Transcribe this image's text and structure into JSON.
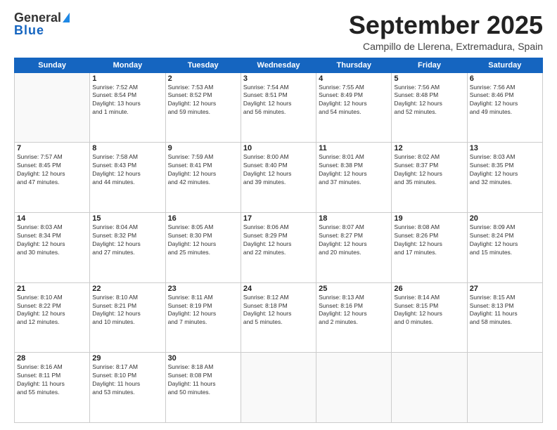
{
  "logo": {
    "line1": "General",
    "line2": "Blue"
  },
  "header": {
    "month": "September 2025",
    "location": "Campillo de Llerena, Extremadura, Spain"
  },
  "weekdays": [
    "Sunday",
    "Monday",
    "Tuesday",
    "Wednesday",
    "Thursday",
    "Friday",
    "Saturday"
  ],
  "weeks": [
    [
      {
        "num": "",
        "info": ""
      },
      {
        "num": "1",
        "info": "Sunrise: 7:52 AM\nSunset: 8:54 PM\nDaylight: 13 hours\nand 1 minute."
      },
      {
        "num": "2",
        "info": "Sunrise: 7:53 AM\nSunset: 8:52 PM\nDaylight: 12 hours\nand 59 minutes."
      },
      {
        "num": "3",
        "info": "Sunrise: 7:54 AM\nSunset: 8:51 PM\nDaylight: 12 hours\nand 56 minutes."
      },
      {
        "num": "4",
        "info": "Sunrise: 7:55 AM\nSunset: 8:49 PM\nDaylight: 12 hours\nand 54 minutes."
      },
      {
        "num": "5",
        "info": "Sunrise: 7:56 AM\nSunset: 8:48 PM\nDaylight: 12 hours\nand 52 minutes."
      },
      {
        "num": "6",
        "info": "Sunrise: 7:56 AM\nSunset: 8:46 PM\nDaylight: 12 hours\nand 49 minutes."
      }
    ],
    [
      {
        "num": "7",
        "info": "Sunrise: 7:57 AM\nSunset: 8:45 PM\nDaylight: 12 hours\nand 47 minutes."
      },
      {
        "num": "8",
        "info": "Sunrise: 7:58 AM\nSunset: 8:43 PM\nDaylight: 12 hours\nand 44 minutes."
      },
      {
        "num": "9",
        "info": "Sunrise: 7:59 AM\nSunset: 8:41 PM\nDaylight: 12 hours\nand 42 minutes."
      },
      {
        "num": "10",
        "info": "Sunrise: 8:00 AM\nSunset: 8:40 PM\nDaylight: 12 hours\nand 39 minutes."
      },
      {
        "num": "11",
        "info": "Sunrise: 8:01 AM\nSunset: 8:38 PM\nDaylight: 12 hours\nand 37 minutes."
      },
      {
        "num": "12",
        "info": "Sunrise: 8:02 AM\nSunset: 8:37 PM\nDaylight: 12 hours\nand 35 minutes."
      },
      {
        "num": "13",
        "info": "Sunrise: 8:03 AM\nSunset: 8:35 PM\nDaylight: 12 hours\nand 32 minutes."
      }
    ],
    [
      {
        "num": "14",
        "info": "Sunrise: 8:03 AM\nSunset: 8:34 PM\nDaylight: 12 hours\nand 30 minutes."
      },
      {
        "num": "15",
        "info": "Sunrise: 8:04 AM\nSunset: 8:32 PM\nDaylight: 12 hours\nand 27 minutes."
      },
      {
        "num": "16",
        "info": "Sunrise: 8:05 AM\nSunset: 8:30 PM\nDaylight: 12 hours\nand 25 minutes."
      },
      {
        "num": "17",
        "info": "Sunrise: 8:06 AM\nSunset: 8:29 PM\nDaylight: 12 hours\nand 22 minutes."
      },
      {
        "num": "18",
        "info": "Sunrise: 8:07 AM\nSunset: 8:27 PM\nDaylight: 12 hours\nand 20 minutes."
      },
      {
        "num": "19",
        "info": "Sunrise: 8:08 AM\nSunset: 8:26 PM\nDaylight: 12 hours\nand 17 minutes."
      },
      {
        "num": "20",
        "info": "Sunrise: 8:09 AM\nSunset: 8:24 PM\nDaylight: 12 hours\nand 15 minutes."
      }
    ],
    [
      {
        "num": "21",
        "info": "Sunrise: 8:10 AM\nSunset: 8:22 PM\nDaylight: 12 hours\nand 12 minutes."
      },
      {
        "num": "22",
        "info": "Sunrise: 8:10 AM\nSunset: 8:21 PM\nDaylight: 12 hours\nand 10 minutes."
      },
      {
        "num": "23",
        "info": "Sunrise: 8:11 AM\nSunset: 8:19 PM\nDaylight: 12 hours\nand 7 minutes."
      },
      {
        "num": "24",
        "info": "Sunrise: 8:12 AM\nSunset: 8:18 PM\nDaylight: 12 hours\nand 5 minutes."
      },
      {
        "num": "25",
        "info": "Sunrise: 8:13 AM\nSunset: 8:16 PM\nDaylight: 12 hours\nand 2 minutes."
      },
      {
        "num": "26",
        "info": "Sunrise: 8:14 AM\nSunset: 8:15 PM\nDaylight: 12 hours\nand 0 minutes."
      },
      {
        "num": "27",
        "info": "Sunrise: 8:15 AM\nSunset: 8:13 PM\nDaylight: 11 hours\nand 58 minutes."
      }
    ],
    [
      {
        "num": "28",
        "info": "Sunrise: 8:16 AM\nSunset: 8:11 PM\nDaylight: 11 hours\nand 55 minutes."
      },
      {
        "num": "29",
        "info": "Sunrise: 8:17 AM\nSunset: 8:10 PM\nDaylight: 11 hours\nand 53 minutes."
      },
      {
        "num": "30",
        "info": "Sunrise: 8:18 AM\nSunset: 8:08 PM\nDaylight: 11 hours\nand 50 minutes."
      },
      {
        "num": "",
        "info": ""
      },
      {
        "num": "",
        "info": ""
      },
      {
        "num": "",
        "info": ""
      },
      {
        "num": "",
        "info": ""
      }
    ]
  ]
}
